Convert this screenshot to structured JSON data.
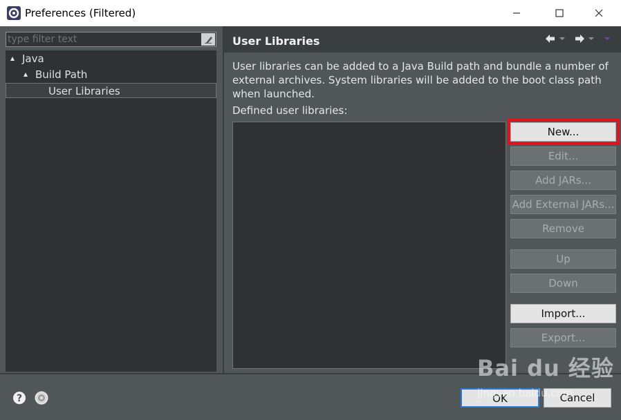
{
  "window": {
    "title": "Preferences (Filtered)"
  },
  "left": {
    "filter_placeholder": "type filter text",
    "tree": [
      {
        "label": "Java",
        "level": 0,
        "expanded": true
      },
      {
        "label": "Build Path",
        "level": 1,
        "expanded": true
      },
      {
        "label": "User Libraries",
        "level": 2,
        "selected": true
      }
    ]
  },
  "right": {
    "title": "User Libraries",
    "description": "User libraries can be added to a Java Build path and bundle a number of external archives. System libraries will be added to the boot class path when launched.",
    "list_label": "Defined user libraries:",
    "buttons": [
      {
        "label": "New...",
        "enabled": true
      },
      {
        "label": "Edit...",
        "enabled": false
      },
      {
        "label": "Add JARs...",
        "enabled": false
      },
      {
        "label": "Add External JARs...",
        "enabled": false
      },
      {
        "label": "Remove",
        "enabled": false
      },
      {
        "label": "Up",
        "enabled": false
      },
      {
        "label": "Down",
        "enabled": false
      },
      {
        "label": "Import...",
        "enabled": true
      },
      {
        "label": "Export...",
        "enabled": false
      }
    ]
  },
  "footer": {
    "ok_label": "OK",
    "cancel_label": "Cancel"
  },
  "watermark": {
    "logo": "Bai du 经验",
    "url": "jingyan.baidu.com"
  },
  "colors": {
    "background": "#515658",
    "dark_panel": "#2f3133",
    "highlight": "#e0141c",
    "default_button_border": "#2c7bd6"
  }
}
